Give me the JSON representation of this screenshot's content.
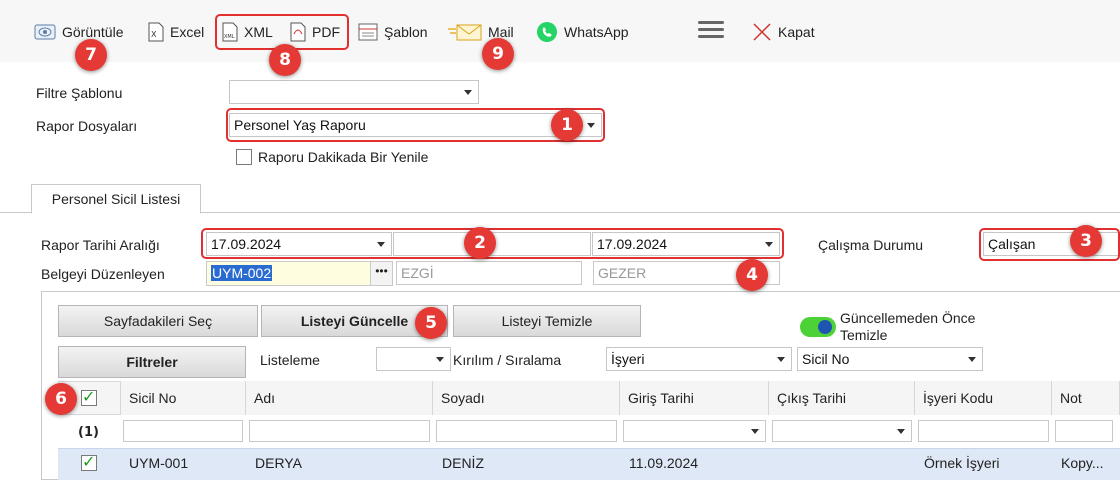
{
  "toolbar": {
    "view_label": "Görüntüle",
    "excel_label": "Excel",
    "xml_label": "XML",
    "pdf_label": "PDF",
    "template_label": "Şablon",
    "mail_label": "Mail",
    "whatsapp_label": "WhatsApp",
    "close_label": "Kapat"
  },
  "form": {
    "filter_template_label": "Filtre Şablonu",
    "filter_template_value": "",
    "report_files_label": "Rapor Dosyaları",
    "report_files_value": "Personel Yaş Raporu",
    "refresh_label": "Raporu Dakikada Bir Yenile"
  },
  "tab": {
    "label": "Personel Sicil Listesi"
  },
  "panel": {
    "date_range_label": "Rapor Tarihi Aralığı",
    "date_start": "17.09.2024",
    "date_end": "17.09.2024",
    "work_status_label": "Çalışma Durumu",
    "work_status_value": "Çalışan",
    "editor_label": "Belgeyi Düzenleyen",
    "editor_code": "UYM-002",
    "editor_first": "EZGİ",
    "editor_last": "GEZER"
  },
  "actions": {
    "select_page": "Sayfadakileri Seç",
    "update_list": "Listeyi Güncelle",
    "clear_list": "Listeyi Temizle",
    "filters": "Filtreler",
    "toggle_label": "Güncellemeden Önce Temizle",
    "listing_label": "Listeleme",
    "listing_value": "",
    "breakdown_label": "Kırılım / Sıralama",
    "breakdown_value": "İşyeri",
    "sort_value": "Sicil No"
  },
  "grid": {
    "columns": [
      "Sicil No",
      "Adı",
      "Soyadı",
      "Giriş Tarihi",
      "Çıkış Tarihi",
      "İşyeri Kodu",
      "Not"
    ],
    "group_count": "(1)",
    "rows": [
      [
        "UYM-001",
        "DERYA",
        "DENİZ",
        "11.09.2024",
        "",
        "Örnek İşyeri",
        "Kopy..."
      ]
    ]
  },
  "badges": [
    "1",
    "2",
    "3",
    "4",
    "5",
    "6",
    "7",
    "8",
    "9"
  ],
  "colors": {
    "badge": "#e53935",
    "highlight_box": "#e03030",
    "selected_row": "#dfe8f7",
    "toggle_on": "#4cd137"
  }
}
